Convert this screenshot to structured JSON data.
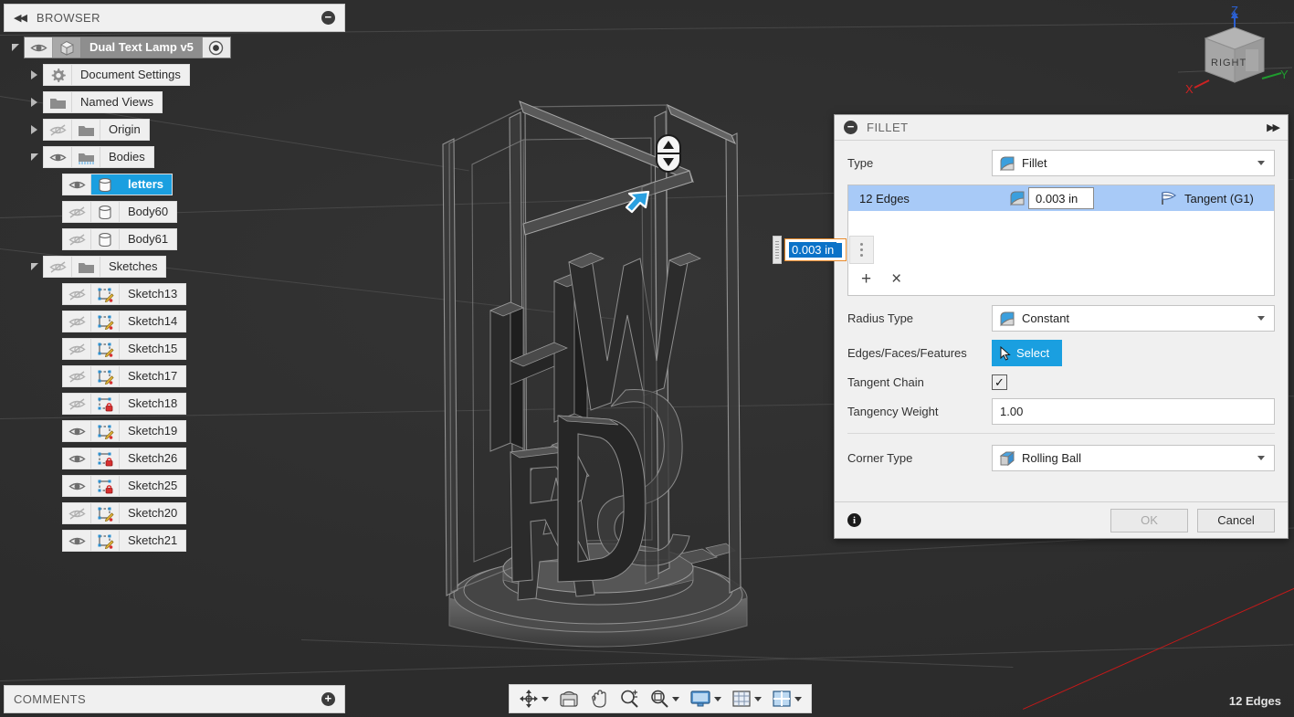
{
  "app": {
    "viewport_bg": "#2e2e2e",
    "accent_blue": "#1a9fe0",
    "select_row_blue": "#a8caf7"
  },
  "browser": {
    "title": "BROWSER",
    "collapse_icon": "collapse-left-arrows-icon",
    "minimize_icon": "minus-circle-icon",
    "root": {
      "label": "Dual Text Lamp v5",
      "visibility_icon": "eye-visible-icon",
      "type_icon": "component-icon",
      "radio_icon": "activate-radio-icon",
      "expander": "expanded"
    },
    "items": [
      {
        "label": "Document Settings",
        "icon": "gear-icon",
        "expander": "collapsed",
        "visibility": "none",
        "indent": 1
      },
      {
        "label": "Named Views",
        "icon": "folder-icon",
        "expander": "collapsed",
        "visibility": "none",
        "indent": 1
      },
      {
        "label": "Origin",
        "icon": "folder-icon",
        "expander": "collapsed",
        "visibility": "hidden",
        "indent": 1
      },
      {
        "label": "Bodies",
        "icon": "folder-bodies-icon",
        "expander": "expanded",
        "visibility": "visible",
        "indent": 1
      },
      {
        "label": "letters",
        "icon": "body-icon",
        "expander": "none",
        "visibility": "visible",
        "indent": 2,
        "selected": true
      },
      {
        "label": "Body60",
        "icon": "body-icon",
        "expander": "none",
        "visibility": "hidden",
        "indent": 2
      },
      {
        "label": "Body61",
        "icon": "body-icon",
        "expander": "none",
        "visibility": "hidden",
        "indent": 2
      },
      {
        "label": "Sketches",
        "icon": "folder-icon",
        "expander": "expanded",
        "visibility": "hidden",
        "indent": 1
      },
      {
        "label": "Sketch13",
        "icon": "sketch-icon",
        "expander": "none",
        "visibility": "hidden",
        "indent": 2
      },
      {
        "label": "Sketch14",
        "icon": "sketch-icon",
        "expander": "none",
        "visibility": "hidden",
        "indent": 2
      },
      {
        "label": "Sketch15",
        "icon": "sketch-icon",
        "expander": "none",
        "visibility": "hidden",
        "indent": 2
      },
      {
        "label": "Sketch17",
        "icon": "sketch-icon",
        "expander": "none",
        "visibility": "hidden",
        "indent": 2
      },
      {
        "label": "Sketch18",
        "icon": "sketch-locked-icon",
        "expander": "none",
        "visibility": "hidden",
        "indent": 2
      },
      {
        "label": "Sketch19",
        "icon": "sketch-icon",
        "expander": "none",
        "visibility": "visible",
        "indent": 2
      },
      {
        "label": "Sketch26",
        "icon": "sketch-locked-icon",
        "expander": "none",
        "visibility": "visible",
        "indent": 2
      },
      {
        "label": "Sketch25",
        "icon": "sketch-locked-icon",
        "expander": "none",
        "visibility": "visible",
        "indent": 2
      },
      {
        "label": "Sketch20",
        "icon": "sketch-icon",
        "expander": "none",
        "visibility": "hidden",
        "indent": 2
      },
      {
        "label": "Sketch21",
        "icon": "sketch-icon",
        "expander": "none",
        "visibility": "visible",
        "indent": 2
      }
    ]
  },
  "comments": {
    "title": "COMMENTS",
    "add_icon": "plus-circle-icon"
  },
  "fillet": {
    "title": "FILLET",
    "collapse_icon": "minus-circle-icon",
    "expand_icon": "double-right-arrow-icon",
    "type": {
      "label": "Type",
      "value": "Fillet",
      "icon": "fillet-icon"
    },
    "edges": {
      "name": "12 Edges",
      "radius": "0.003 in",
      "radius_icon": "fillet-icon",
      "continuity": "Tangent (G1)",
      "continuity_icon": "tangent-flag-icon",
      "add_label": "+",
      "remove_label": "×"
    },
    "radius_type": {
      "label": "Radius Type",
      "value": "Constant",
      "icon": "constant-radius-icon"
    },
    "selection": {
      "label": "Edges/Faces/Features",
      "button": "Select",
      "icon": "cursor-arrow-icon"
    },
    "tangent_chain": {
      "label": "Tangent Chain",
      "checked": true,
      "check_glyph": "✓"
    },
    "tangency_weight": {
      "label": "Tangency Weight",
      "value": "1.00"
    },
    "corner_type": {
      "label": "Corner Type",
      "value": "Rolling Ball",
      "icon": "rolling-ball-icon"
    },
    "footer": {
      "info_icon": "info-icon",
      "ok": "OK",
      "cancel": "Cancel"
    }
  },
  "float_input": {
    "value": "0.003 in",
    "grip_icon": "drag-grip-icon",
    "menu_icon": "kebab-menu-icon"
  },
  "navbar": {
    "items": [
      {
        "name": "orbit-icon",
        "has_caret": true
      },
      {
        "name": "look-at-icon",
        "has_caret": false
      },
      {
        "name": "pan-hand-icon",
        "has_caret": false
      },
      {
        "name": "zoom-magnifier-icon",
        "has_caret": false
      },
      {
        "name": "zoom-window-icon",
        "has_caret": true
      },
      {
        "name": "display-settings-icon",
        "has_caret": true
      },
      {
        "name": "grid-snaps-icon",
        "has_caret": true
      },
      {
        "name": "viewports-icon",
        "has_caret": true
      }
    ]
  },
  "status": {
    "edges": "12 Edges"
  },
  "viewcube": {
    "face": "RIGHT",
    "axis_z": "Z",
    "axis_x": "X",
    "axis_y": "Y",
    "color_z": "#2b5fd0",
    "color_x": "#cc2222",
    "color_y": "#1f9a2e"
  },
  "model": {
    "letters": [
      "H",
      "W",
      "A",
      "R",
      "D"
    ],
    "gizmo_icon": "up-down-arrows-icon",
    "cursor_icon": "selection-arrow-cursor-icon"
  }
}
